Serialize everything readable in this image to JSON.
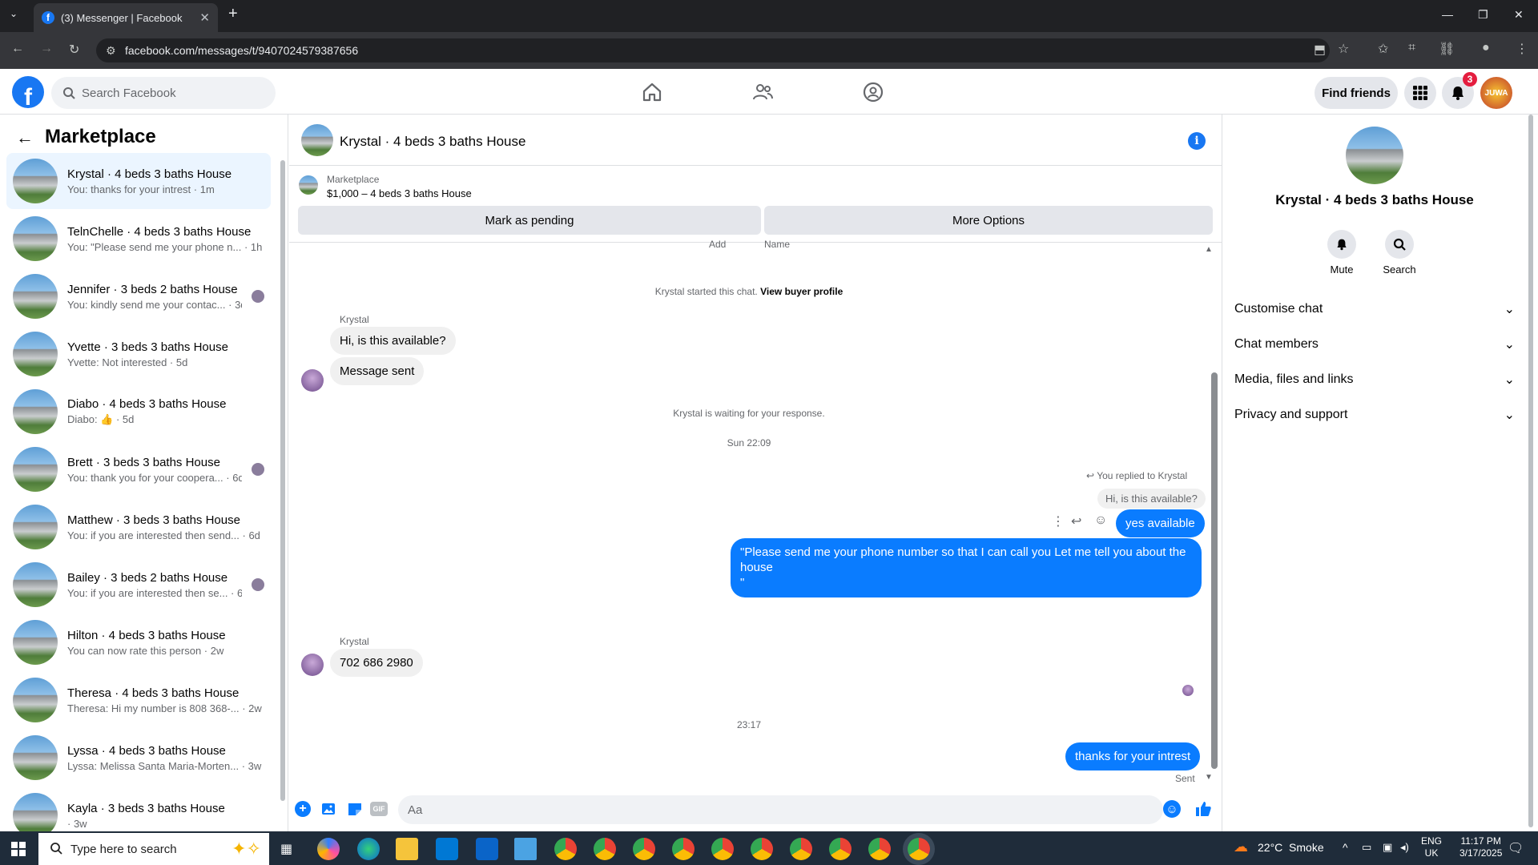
{
  "browser": {
    "tab_title": "(3) Messenger | Facebook",
    "url": "facebook.com/messages/t/9407024579387656"
  },
  "fb_header": {
    "search_placeholder": "Search Facebook",
    "find_friends": "Find friends",
    "notification_count": "3",
    "avatar_text": "JUWA"
  },
  "sidebar": {
    "title": "Marketplace",
    "conversations": [
      {
        "name": "Krystal · 4 beds 3 baths House",
        "preview": "You: thanks for your intrest · 1m"
      },
      {
        "name": "TelnChelle · 4 beds 3 baths House",
        "preview": "You: \"Please send me your phone n... · 1h"
      },
      {
        "name": "Jennifer · 3 beds 2 baths House",
        "preview": "You: kindly send me your contac... · 3d"
      },
      {
        "name": "Yvette · 3 beds 3 baths House",
        "preview": "Yvette: Not interested · 5d"
      },
      {
        "name": "Diabo · 4 beds 3 baths House",
        "preview": "Diabo: 👍 · 5d"
      },
      {
        "name": "Brett · 3 beds 3 baths House",
        "preview": "You: thank you for your coopera... · 6d"
      },
      {
        "name": "Matthew · 3 beds 3 baths House",
        "preview": "You: if you are interested then send... · 6d"
      },
      {
        "name": "Bailey · 3 beds 2 baths House",
        "preview": "You: if you are interested then se... · 6d"
      },
      {
        "name": "Hilton · 4 beds 3 baths House",
        "preview": "You can now rate this person · 2w"
      },
      {
        "name": "Theresa · 4 beds 3 baths House",
        "preview": "Theresa: Hi my number is 808 368-... · 2w"
      },
      {
        "name": "Lyssa · 4 beds 3 baths House",
        "preview": "Lyssa: Melissa Santa Maria-Morten... · 3w"
      },
      {
        "name": "Kayla · 3 beds 3 baths House",
        "preview": "· 3w"
      }
    ]
  },
  "chat": {
    "title": "Krystal · 4 beds 3 baths House",
    "marketplace_label": "Marketplace",
    "listing": "$1,000 – 4 beds 3 baths House",
    "mark_pending": "Mark as pending",
    "more_options": "More Options",
    "clipped_labels": [
      "Add",
      "Name"
    ],
    "started_note": "Krystal started this chat.",
    "view_buyer": "View buyer profile",
    "sender_name": "Krystal",
    "msg1": "Hi, is this available?",
    "msg2": "Message sent",
    "waiting_note": "Krystal is waiting for your response.",
    "time1": "Sun 22:09",
    "replied_to": "You replied to Krystal",
    "quoted": "Hi, is this available?",
    "out1": "yes available",
    "out2": "\"Please send me your phone number so that I can call you Let me tell you about the house\n\"",
    "sender_name2": "Krystal",
    "msg3": "702 686 2980",
    "time2": "23:17",
    "out3": "thanks for your intrest",
    "sent_status": "Sent",
    "composer_placeholder": "Aa"
  },
  "right_panel": {
    "title": "Krystal · 4 beds 3 baths House",
    "mute": "Mute",
    "search": "Search",
    "sections": [
      "Customise chat",
      "Chat members",
      "Media, files and links",
      "Privacy and support"
    ]
  },
  "taskbar": {
    "search_placeholder": "Type here to search",
    "weather": "22°C  Smoke",
    "lang": "ENG",
    "region": "UK",
    "time": "11:17 PM",
    "date": "3/17/2025"
  },
  "colors": {
    "fb_blue": "#1877f2",
    "bubble_blue": "#0a7cff",
    "notif_red": "#e41e3f"
  }
}
